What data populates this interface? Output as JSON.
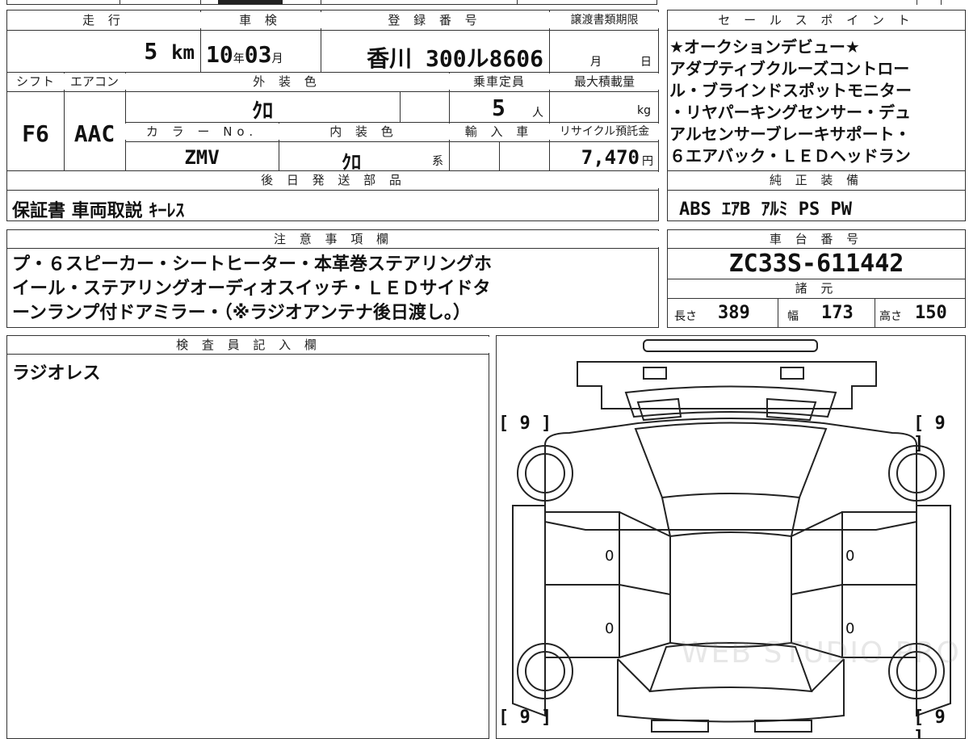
{
  "header_row": {
    "mileage_label": "走 行",
    "inspection_label": "車 検",
    "registration_label": "登 録 番 号",
    "transfer_deadline_label": "譲渡書類期限",
    "sales_points_label": "セ ー ル ス ポ イ ン ト"
  },
  "mileage": {
    "value": "5",
    "unit": "km"
  },
  "inspection": {
    "year": "10",
    "year_unit": "年",
    "month": "03",
    "month_unit": "月"
  },
  "registration": {
    "value": "香川 300ル8606"
  },
  "transfer_deadline": {
    "month_unit": "月",
    "day_unit": "日"
  },
  "sales_points": {
    "lines": [
      "★オークションデビュー★",
      "アダプティブクルーズコントロー",
      "ル・ブラインドスポットモニター",
      "・リヤパーキングセンサー・デュ",
      "アルセンサーブレーキサポート・",
      "６エアバック・ＬＥＤヘッドラン"
    ]
  },
  "row2_labels": {
    "shift": "シフト",
    "aircon": "エアコン",
    "exterior_color": "外 装 色",
    "capacity": "乗車定員",
    "max_load": "最大積載量"
  },
  "shift": "F6",
  "aircon": "AAC",
  "exterior_color": "ｸﾛ",
  "capacity": {
    "value": "5",
    "unit": "人"
  },
  "max_load": {
    "unit": "kg"
  },
  "row3_labels": {
    "color_no": "カ ラ ー No.",
    "interior_color": "内 装 色",
    "import_car": "輸 入 車",
    "recycle_fee": "リサイクル預託金"
  },
  "color_no": "ZMV",
  "interior_color": {
    "value": "ｸﾛ",
    "unit": "系"
  },
  "recycle_fee": {
    "value": "7,470",
    "unit": "円"
  },
  "later_parts": {
    "label": "後 日 発 送 部 品",
    "value": "保証書 車両取説 ｷｰﾚｽ"
  },
  "genuine_equipment": {
    "label": "純 正 装 備",
    "value": "ABS ｴｱB ｱﾙﾐ PS PW"
  },
  "notes": {
    "label": "注 意 事 項 欄",
    "lines": [
      "プ・６スピーカー・シートヒーター・本革巻ステアリングホ",
      "イール・ステアリングオーディオスイッチ・ＬＥＤサイドタ",
      "ーンランプ付ドアミラー・（※ラジオアンテナ後日渡し。）"
    ]
  },
  "chassis": {
    "label": "車 台 番 号",
    "value": "ZC33S-611442"
  },
  "specs": {
    "label": "諸 元",
    "length_label": "長さ",
    "length": "389",
    "width_label": "幅",
    "width": "173",
    "height_label": "高さ",
    "height": "150"
  },
  "inspector": {
    "label": "検 査 員 記 入 欄",
    "value": "ラジオレス"
  },
  "diagram": {
    "tire_fl": "[ 9 ]",
    "tire_fr": "[ 9 ]",
    "tire_rl": "[ 9 ]",
    "tire_rr": "[ 9 ]",
    "door_marks": [
      "0",
      "0",
      "0",
      "0"
    ],
    "watermark": "WEB STUDIO PRO"
  }
}
